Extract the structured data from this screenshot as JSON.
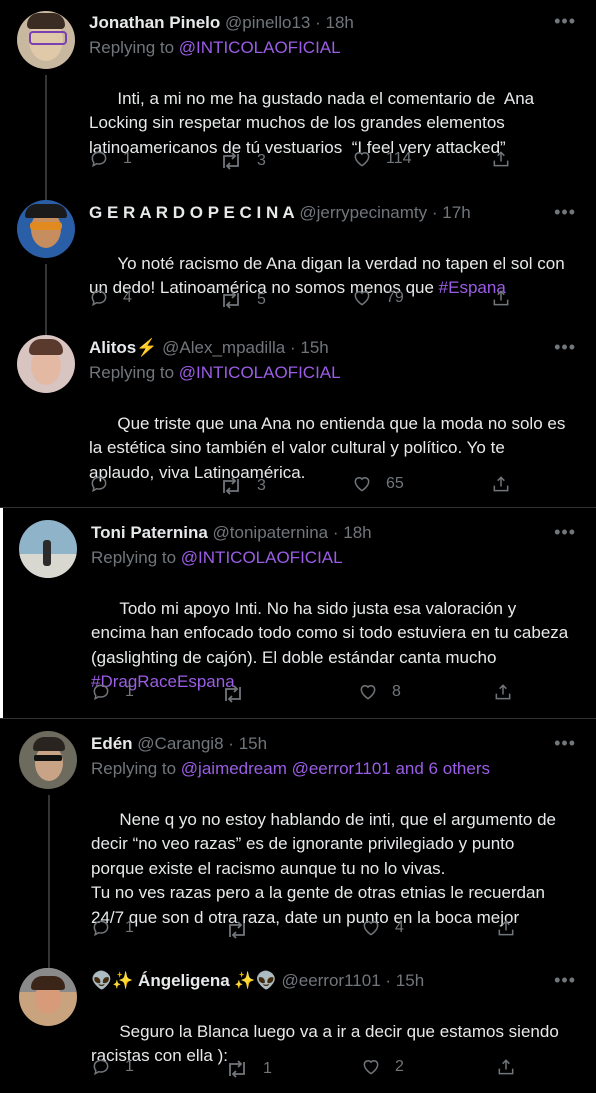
{
  "tweets": [
    {
      "name": "Jonathan Pinelo",
      "handle": "@pinello13",
      "time": "18h",
      "replying_label": "Replying to",
      "replying_to": "@INTICOLAOFICIAL",
      "text": "Inti, a mi no me ha gustado nada el comentario de  Ana Locking sin respetar muchos de los grandes elementos latinoamericanos de tú vestuarios  “I feel very attacked”",
      "hashtag": "",
      "replies": "1",
      "retweets": "3",
      "likes": "114"
    },
    {
      "name": "G E R A R D O P E C I N A",
      "handle": "@jerrypecinamty",
      "time": "17h",
      "replying_label": "",
      "replying_to": "",
      "text": "Yo noté racismo de Ana digan la verdad no tapen el sol con un dedo! Latinoamérica no somos menos que ",
      "hashtag": "#Espana",
      "replies": "4",
      "retweets": "5",
      "likes": "79"
    },
    {
      "name": "Alitos⚡",
      "handle": "@Alex_mpadilla",
      "time": "15h",
      "replying_label": "Replying to",
      "replying_to": "@INTICOLAOFICIAL",
      "text": "Que triste que una Ana no entienda que la moda no solo es la estética sino también el valor cultural y político. Yo te aplaudo, viva Latinoamérica.",
      "hashtag": "",
      "replies": "",
      "retweets": "3",
      "likes": "65"
    },
    {
      "name": "Toni Paternina",
      "handle": "@tonipaternina",
      "time": "18h",
      "replying_label": "Replying to",
      "replying_to": "@INTICOLAOFICIAL",
      "text": "Todo mi apoyo Inti. No ha sido justa esa valoración y encima han enfocado todo como si todo estuviera en tu cabeza (gaslighting de cajón). El doble estándar canta mucho\n",
      "hashtag": "#DragRaceEspana",
      "replies": "1",
      "retweets": "",
      "likes": "8"
    },
    {
      "name": "Edén",
      "handle": "@Carangi8",
      "time": "15h",
      "replying_label": "Replying to",
      "replying_to": "@jaimedream @eerror1101 and 6 others",
      "text": "Nene q yo no estoy hablando de inti, que el argumento de decir “no veo razas” es de ignorante privilegiado y punto porque existe el racismo aunque tu no lo vivas.\nTu no ves razas pero a la gente de otras etnias le recuerdan 24/7 que son d otra raza, date un punto en la boca mejor",
      "hashtag": "",
      "replies": "1",
      "retweets": "",
      "likes": "4"
    },
    {
      "name": "👽✨ Ángeligena ✨👽",
      "handle": "@eerror1101",
      "time": "15h",
      "replying_label": "",
      "replying_to": "",
      "text": "Seguro la Blanca luego va a ir a decir que estamos siendo racistas con ella ):",
      "hashtag": "",
      "replies": "1",
      "retweets": "1",
      "likes": "2"
    }
  ],
  "more_label": "•••",
  "separator": "·",
  "colors": {
    "accent": "#9b5de5",
    "background": "#000000",
    "muted": "#71767b"
  },
  "icons": [
    "reply-icon",
    "retweet-icon",
    "like-icon",
    "share-icon",
    "more-icon"
  ]
}
